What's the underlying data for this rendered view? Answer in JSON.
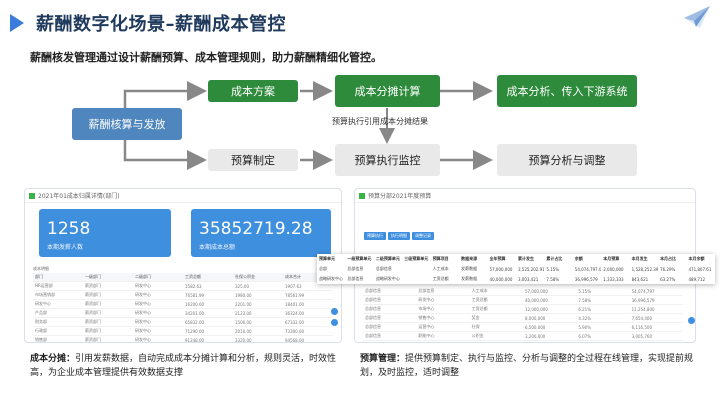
{
  "header": {
    "title": "薪酬数字化场景–薪酬成本管控",
    "subtitle": "薪酬核发管理通过设计薪酬预算、成本管理规则，助力薪酬精细化管控。"
  },
  "flow": {
    "root": "薪酬核算与发放",
    "top_row": [
      "成本方案",
      "成本分摊计算",
      "成本分析、传入下游系统"
    ],
    "bottom_row": [
      "预算制定",
      "预算执行监控",
      "预算分析与调整"
    ],
    "note": "预算执行引用成本分摊结果"
  },
  "left_panel": {
    "title": "2021年01成本归属详情(部门)",
    "stat1_value": "1258",
    "stat1_label": "本期发薪人数",
    "stat2_value": "35852719.28",
    "stat2_label": "本期成本总额",
    "table_title": "成本明细",
    "headers": [
      "部门",
      "一级部门",
      "二级部门",
      "工资总额",
      "社保公积金",
      "成本合计"
    ],
    "rows": [
      [
        "HR运营部",
        "薪资部门",
        "研发中心",
        "1582.63",
        "325.00",
        "1907.63"
      ],
      [
        "市场营销部",
        "薪资部门",
        "研发中心",
        "76581.99",
        "1980.00",
        "78561.99"
      ],
      [
        "研发中心",
        "薪资部门",
        "研发中心",
        "16200.00",
        "2201.00",
        "18401.00"
      ],
      [
        "产品部",
        "薪资部门",
        "研发中心",
        "34201.00",
        "2123.00",
        "36324.00"
      ],
      [
        "财务部",
        "薪资部门",
        "研发中心",
        "65832.00",
        "1500.00",
        "67332.00"
      ],
      [
        "行政部",
        "薪资部门",
        "研发中心",
        "71290.00",
        "2010.00",
        "73300.00"
      ],
      [
        "销售部",
        "薪资部门",
        "研发中心",
        "91248.00",
        "3320.00",
        "94568.00"
      ],
      [
        "客服部",
        "薪资部门",
        "研发中心",
        "22710.00",
        "1120.00",
        "23830.00"
      ]
    ]
  },
  "right_panel": {
    "title": "预算分部2021年度预算",
    "tabs": [
      "预算执行",
      "执行明细",
      "调整记录"
    ],
    "overlay_headers": [
      "预算单元",
      "一级预算单元",
      "二级预算单元",
      "三级预算单元",
      "预算项目",
      "数据来源",
      "全年预算",
      "累计发生",
      "累计占比",
      "余额",
      "本月预算",
      "本月发生",
      "本月占比",
      "本月余额"
    ],
    "overlay_rows": [
      [
        "总部",
        "总部信息",
        "总部信息",
        "",
        "人工成本",
        "发薪数据",
        "57,000,000",
        "3,525,202.91",
        "5.15%",
        "54,074,797.09",
        "2,000,000",
        "1,528,252.39",
        "76.29%",
        "471,807.61"
      ],
      [
        "战略研发中心",
        "总部信息",
        "战略研发中心",
        "",
        "工资总额",
        "发薪数据",
        "40,000,000",
        "3,003,421",
        "7.58%",
        "36,996,579",
        "1,333,333",
        "843,621",
        "63.27%",
        "489,712"
      ]
    ],
    "rows": [
      [
        "总部信息",
        "总部信息",
        "人工成本",
        "57,000,000",
        "5.15%",
        "54,074,797"
      ],
      [
        "总部信息",
        "研发中心",
        "工资总额",
        "40,000,000",
        "7.58%",
        "36,996,579"
      ],
      [
        "总部信息",
        "市场中心",
        "工资总额",
        "12,000,000",
        "6.21%",
        "11,254,800"
      ],
      [
        "总部信息",
        "销售中心",
        "奖金",
        "8,000,000",
        "4.32%",
        "7,654,400"
      ],
      [
        "总部信息",
        "运营中心",
        "社保",
        "6,500,000",
        "5.90%",
        "6,116,500"
      ],
      [
        "总部信息",
        "职能中心",
        "公积金",
        "3,200,000",
        "6.07%",
        "3,005,760"
      ],
      [
        "总部信息",
        "客服中心",
        "福利费",
        "1,800,000",
        "3.11%",
        "1,744,020"
      ],
      [
        "总部信息",
        "财务中心",
        "工资总额",
        "2,400,000",
        "5.44%",
        "2,269,440"
      ]
    ]
  },
  "captions": {
    "left_bold": "成本分摊：",
    "left_text": "引用发薪数据，自动完成成本分摊计算和分析，规则灵活，时效性高，为企业成本管理提供有效数据支撑",
    "right_bold": "预算管理：",
    "right_text": "提供预算制定、执行与监控、分析与调整的全过程在线管理，实现提前规划，及时监控，适时调整"
  },
  "colors": {
    "blue_box": "#4f86bd",
    "green_box": "#2e8b3c",
    "gray_box": "#e9e9e9",
    "title": "#1f3a5c",
    "stat_blue": "#3f8fdf"
  }
}
